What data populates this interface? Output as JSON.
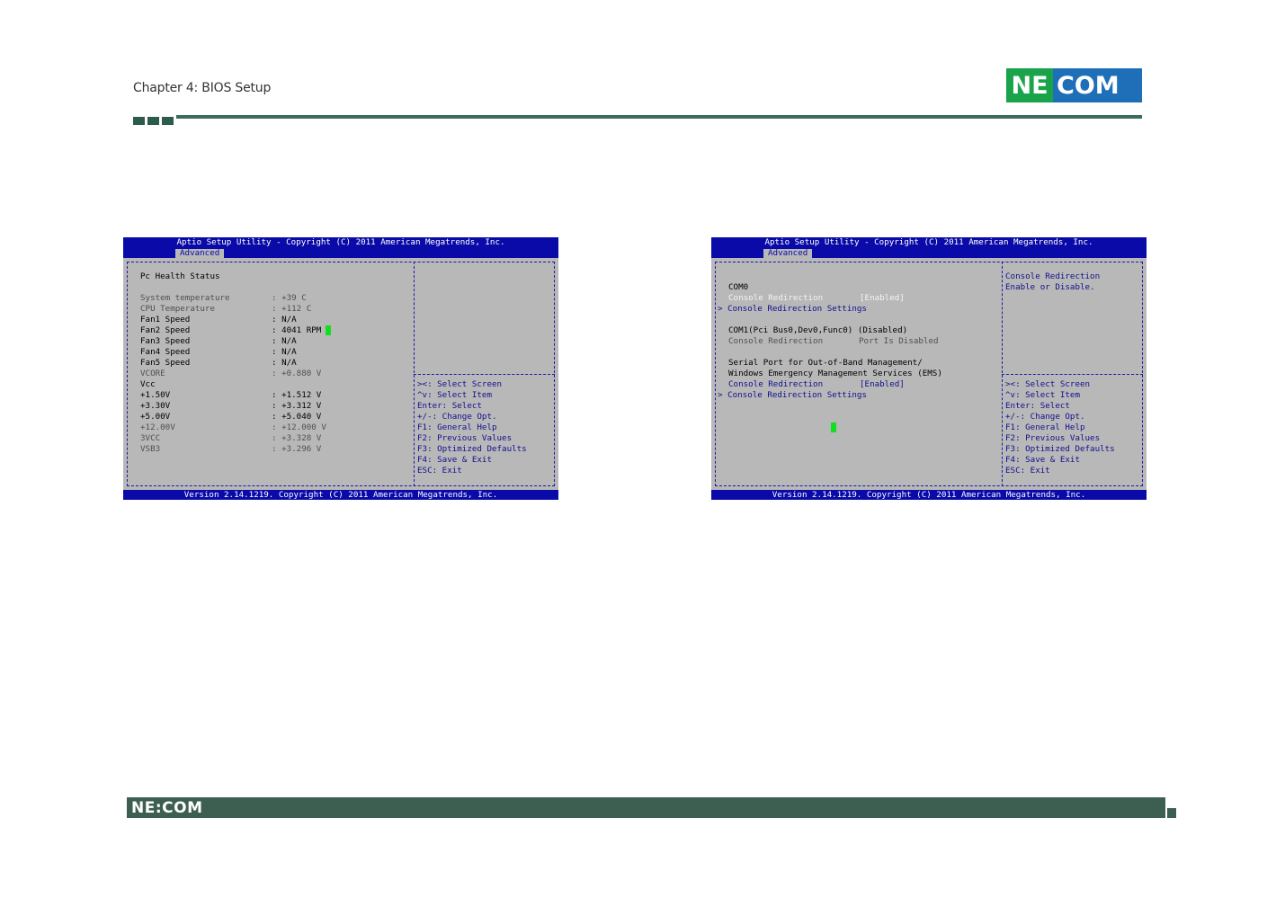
{
  "header": {
    "chapter": "Chapter 4: BIOS Setup",
    "logo_left": "NE",
    "logo_right": "COM",
    "brand_colors": {
      "green": "#1aa34a",
      "blue": "#1e6fb8",
      "rule": "#3d6b5d"
    }
  },
  "bios_left": {
    "title": "Aptio Setup Utility - Copyright (C) 2011 American Megatrends, Inc.",
    "tab": "Advanced",
    "footer": "Version 2.14.1219. Copyright (C) 2011 American Megatrends, Inc.",
    "section": "Pc Health Status",
    "rows": [
      {
        "label": "System temperature",
        "value": ": +39 C"
      },
      {
        "label": "CPU Temperature",
        "value": ": +112 C"
      },
      {
        "label": "Fan1 Speed",
        "value": ": N/A"
      },
      {
        "label": "Fan2 Speed",
        "value": ": 4041 RPM"
      },
      {
        "label": "Fan3 Speed",
        "value": ": N/A"
      },
      {
        "label": "Fan4 Speed",
        "value": ": N/A"
      },
      {
        "label": "Fan5 Speed",
        "value": ": N/A"
      },
      {
        "label": "VCORE",
        "value": ": +0.880 V"
      },
      {
        "label": "Vcc",
        "value": ""
      },
      {
        "label": "+1.50V",
        "value": ": +1.512 V"
      },
      {
        "label": "+3.30V",
        "value": ": +3.312 V"
      },
      {
        "label": "+5.00V",
        "value": ": +5.040 V"
      },
      {
        "label": "+12.00V",
        "value": ": +12.000 V"
      },
      {
        "label": "3VCC",
        "value": ": +3.328 V"
      },
      {
        "label": "VSB3",
        "value": ": +3.296 V"
      }
    ],
    "help_keys": [
      "><: Select Screen",
      "^v: Select Item",
      "Enter: Select",
      "+/-: Change Opt.",
      "F1: General Help",
      "F2: Previous Values",
      "F3: Optimized Defaults",
      "F4: Save & Exit",
      "ESC: Exit"
    ]
  },
  "bios_right": {
    "title": "Aptio Setup Utility - Copyright (C) 2011 American Megatrends, Inc.",
    "tab": "Advanced",
    "footer": "Version 2.14.1219. Copyright (C) 2011 American Megatrends, Inc.",
    "help_text": [
      "Console Redirection",
      "Enable or Disable."
    ],
    "com0_heading": "COM0",
    "com0_redirection_label": "Console Redirection",
    "com0_redirection_value": "[Enabled]",
    "com0_settings": "> Console Redirection Settings",
    "com1_heading": "COM1(Pci Bus0,Dev0,Func0) (Disabled)",
    "com1_redirection_label": "Console Redirection",
    "com1_redirection_value": "Port Is Disabled",
    "ems_line1": "Serial Port for Out-of-Band Management/",
    "ems_line2": "Windows Emergency Management Services (EMS)",
    "ems_redirection_label": "Console Redirection",
    "ems_redirection_value": "[Enabled]",
    "ems_settings": "> Console Redirection Settings",
    "help_keys": [
      "><: Select Screen",
      "^v: Select Item",
      "Enter: Select",
      "+/-: Change Opt.",
      "F1: General Help",
      "F2: Previous Values",
      "F3: Optimized Defaults",
      "F4: Save & Exit",
      "ESC: Exit"
    ]
  },
  "footer": {
    "logo": "NE:COM"
  }
}
